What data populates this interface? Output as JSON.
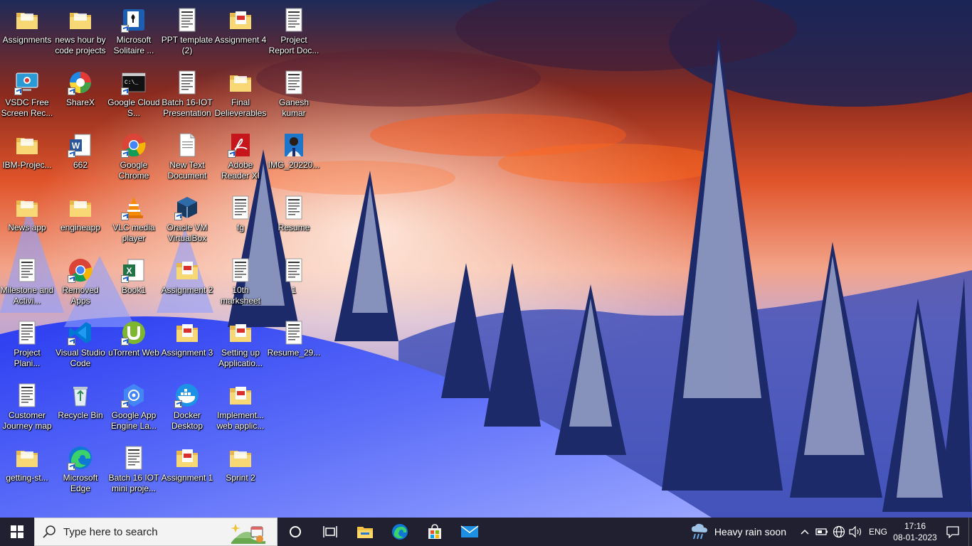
{
  "desktop": {
    "icons": [
      {
        "label": "Assignments",
        "icon": "folder-icon"
      },
      {
        "label": "news hour by code projects",
        "icon": "folder-icon"
      },
      {
        "label": "Microsoft Solitaire ...",
        "icon": "solitaire-icon"
      },
      {
        "label": "PPT template (2)",
        "icon": "document-thumb-icon"
      },
      {
        "label": "Assignment 4",
        "icon": "pdf-folder-icon"
      },
      {
        "label": "Project Report Doc...",
        "icon": "document-thumb-icon"
      },
      {
        "label": "VSDC Free Screen Rec...",
        "icon": "screen-recorder-icon"
      },
      {
        "label": "ShareX",
        "icon": "sharex-icon"
      },
      {
        "label": "Google Cloud S...",
        "icon": "terminal-icon"
      },
      {
        "label": "Batch 16-IOT Presentation",
        "icon": "document-thumb-icon"
      },
      {
        "label": "Final Delieverables",
        "icon": "folder-icon"
      },
      {
        "label": "Ganesh kumar",
        "icon": "document-thumb-icon"
      },
      {
        "label": "IBM-Projec...",
        "icon": "folder-icon"
      },
      {
        "label": "662",
        "icon": "word-document-icon"
      },
      {
        "label": "Google Chrome",
        "icon": "chrome-icon"
      },
      {
        "label": "New Text Document",
        "icon": "text-document-icon"
      },
      {
        "label": "Adobe Reader XI",
        "icon": "adobe-reader-icon"
      },
      {
        "label": "IMG_20220...",
        "icon": "photo-icon"
      },
      {
        "label": "News app",
        "icon": "folder-icon"
      },
      {
        "label": "engineapp",
        "icon": "folder-icon"
      },
      {
        "label": "VLC media player",
        "icon": "vlc-icon"
      },
      {
        "label": "Oracle VM VirtualBox",
        "icon": "virtualbox-icon"
      },
      {
        "label": "fg",
        "icon": "document-thumb-icon"
      },
      {
        "label": "Resume",
        "icon": "document-thumb-icon"
      },
      {
        "label": "Milestone and  Activi...",
        "icon": "document-thumb-icon"
      },
      {
        "label": "Removed Apps",
        "icon": "chrome-icon"
      },
      {
        "label": "Book1",
        "icon": "excel-icon"
      },
      {
        "label": "Assignment 2",
        "icon": "pdf-folder-icon"
      },
      {
        "label": "10th marksheet",
        "icon": "document-thumb-icon"
      },
      {
        "label": "1",
        "icon": "document-thumb-icon"
      },
      {
        "label": "Project Plani...",
        "icon": "document-thumb-icon"
      },
      {
        "label": "Visual Studio Code",
        "icon": "vscode-icon"
      },
      {
        "label": "uTorrent Web",
        "icon": "utorrent-icon"
      },
      {
        "label": "Assignment 3",
        "icon": "pdf-folder-icon"
      },
      {
        "label": "Setting up Applicatio...",
        "icon": "pdf-folder-icon"
      },
      {
        "label": "Resume_29...",
        "icon": "document-thumb-icon"
      },
      {
        "label": "Customer Journey map",
        "icon": "document-thumb-icon"
      },
      {
        "label": "Recycle Bin",
        "icon": "recycle-bin-icon"
      },
      {
        "label": "Google App Engine La...",
        "icon": "app-engine-icon"
      },
      {
        "label": "Docker Desktop",
        "icon": "docker-icon"
      },
      {
        "label": "Implement... web applic...",
        "icon": "pdf-folder-icon"
      },
      {
        "label": "getting-st...",
        "icon": "folder-icon"
      },
      {
        "label": "Microsoft Edge",
        "icon": "edge-icon"
      },
      {
        "label": "Batch 16 IOT mini proje...",
        "icon": "document-thumb-icon"
      },
      {
        "label": "Assignment 1",
        "icon": "pdf-folder-icon"
      },
      {
        "label": "Sprint 2",
        "icon": "folder-icon"
      }
    ]
  },
  "taskbar": {
    "search_placeholder": "Type here to search",
    "pinned": [
      "task-view",
      "file-explorer",
      "edge",
      "microsoft-store",
      "mail"
    ],
    "weather": "Heavy rain soon",
    "language": "ENG",
    "time": "17:16",
    "date": "08-01-2023"
  },
  "colors": {
    "taskbar": "#202030",
    "accent": "#1a73e8"
  }
}
